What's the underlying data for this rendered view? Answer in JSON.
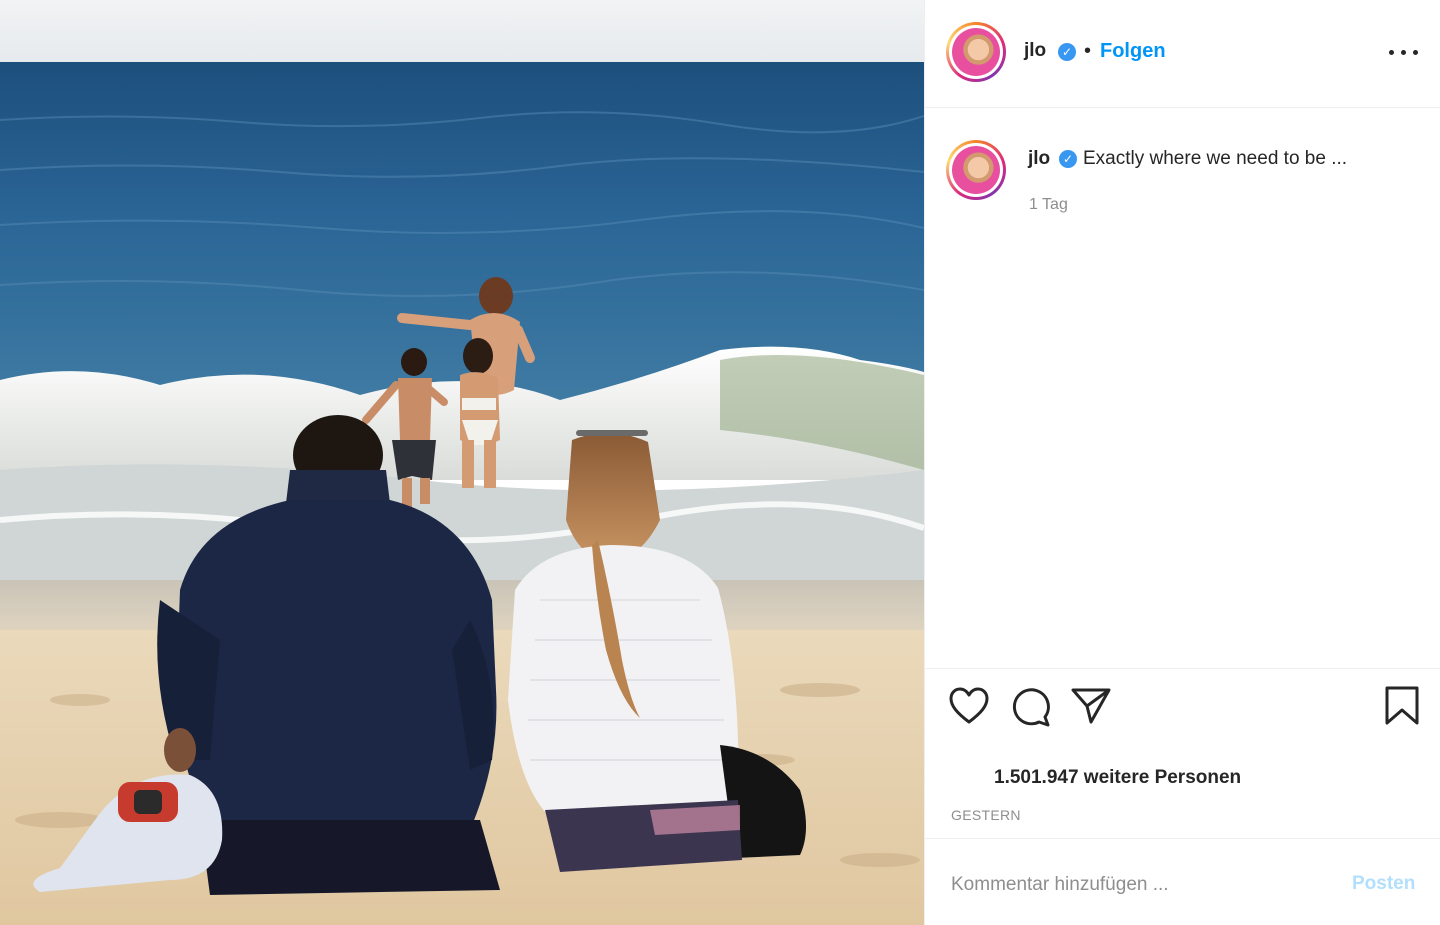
{
  "photo": {
    "description_icon": "beach-photo"
  },
  "header": {
    "username": "jlo",
    "separator": "•",
    "follow_label": "Folgen",
    "more_icon": "more-options-icon"
  },
  "caption": {
    "username": "jlo",
    "text": "Exactly where we need to be ...",
    "time_ago": "1 Tag"
  },
  "actions": {
    "like_icon": "heart-icon",
    "comment_icon": "comment-icon",
    "share_icon": "paper-plane-icon",
    "save_icon": "bookmark-icon"
  },
  "likes": {
    "text": "1.501.947 weitere Personen"
  },
  "posted_date": "GESTERN",
  "comment": {
    "placeholder": "Kommentar hinzufügen ...",
    "post_label": "Posten"
  },
  "colors": {
    "accent": "#0095f6",
    "post_disabled": "#b2dffc",
    "verified": "#3897f0",
    "muted": "#8e8e8e"
  }
}
